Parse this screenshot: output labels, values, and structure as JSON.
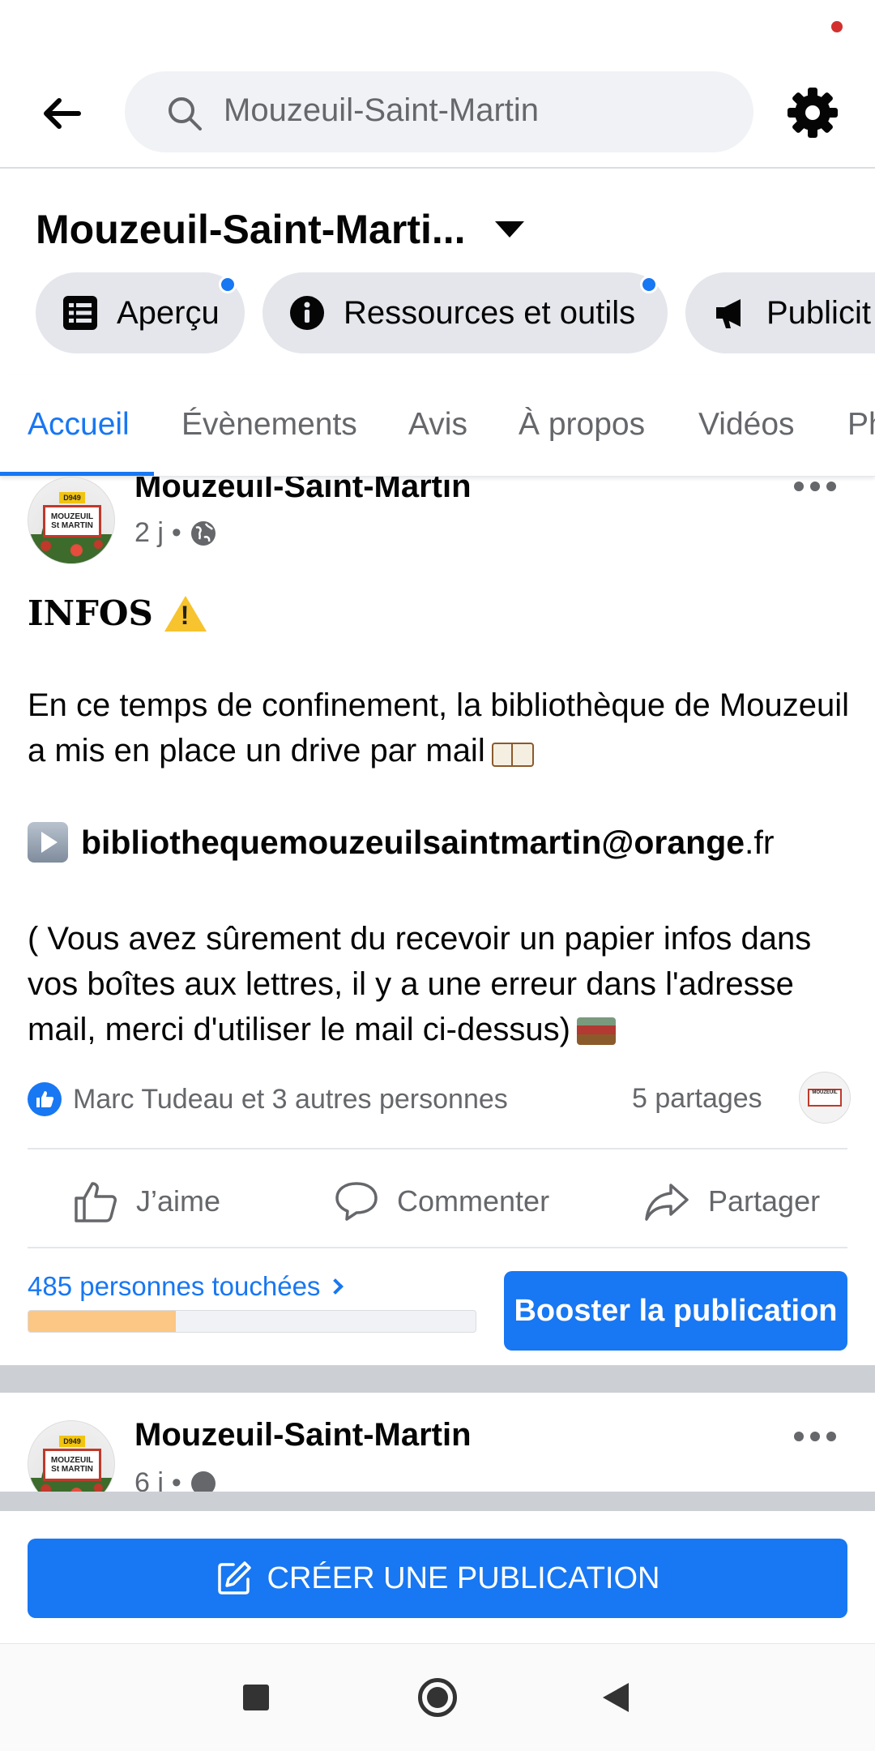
{
  "search": {
    "value": "Mouzeuil-Saint-Martin"
  },
  "page": {
    "title": "Mouzeuil-Saint-Marti..."
  },
  "chips": [
    {
      "label": "Aperçu",
      "icon": "list-icon",
      "notification_dot": true
    },
    {
      "label": "Ressources et outils",
      "icon": "info-icon",
      "notification_dot": true
    },
    {
      "label": "Publicit",
      "icon": "megaphone-icon",
      "notification_dot": false
    }
  ],
  "tabs": [
    {
      "label": "Accueil",
      "active": true
    },
    {
      "label": "Évènements",
      "active": false
    },
    {
      "label": "Avis",
      "active": false
    },
    {
      "label": "À propos",
      "active": false
    },
    {
      "label": "Vidéos",
      "active": false
    },
    {
      "label": "Ph",
      "active": false
    }
  ],
  "post": {
    "author": "Mouzeuil-Saint-Martin",
    "time": "2 j",
    "separator": "•",
    "heading": "INFOS",
    "paragraph1": "En ce temps de confinement, la bibliothèque de Mouzeuil a mis en place un drive par mail",
    "email_bold": "bibliothequemouzeuilsaintmartin@orange",
    "email_tail": ".fr",
    "paragraph2": "( Vous avez sûrement du recevoir un papier infos dans vos boîtes aux lettres, il y a une erreur dans l'adresse mail, merci d'utiliser le mail ci-dessus)",
    "reactions_text": "Marc Tudeau et 3 autres personnes",
    "shares_text": "5 partages",
    "actions": {
      "like": "J’aime",
      "comment": "Commenter",
      "share": "Partager"
    },
    "reach_text": "485 personnes touchées",
    "reach_progress_fraction": 0.33,
    "boost_label": "Booster la publication"
  },
  "avatar_text": {
    "plate": "D949",
    "line1": "MOUZEUIL",
    "line2": "St MARTIN"
  },
  "post2": {
    "author": "Mouzeuil-Saint-Martin",
    "time": "6 j"
  },
  "create_button": {
    "label": "CRÉER UNE PUBLICATION"
  },
  "colors": {
    "accent": "#1877f2",
    "reach_fill": "#fcc685",
    "status_dot": "#d32f2f"
  }
}
